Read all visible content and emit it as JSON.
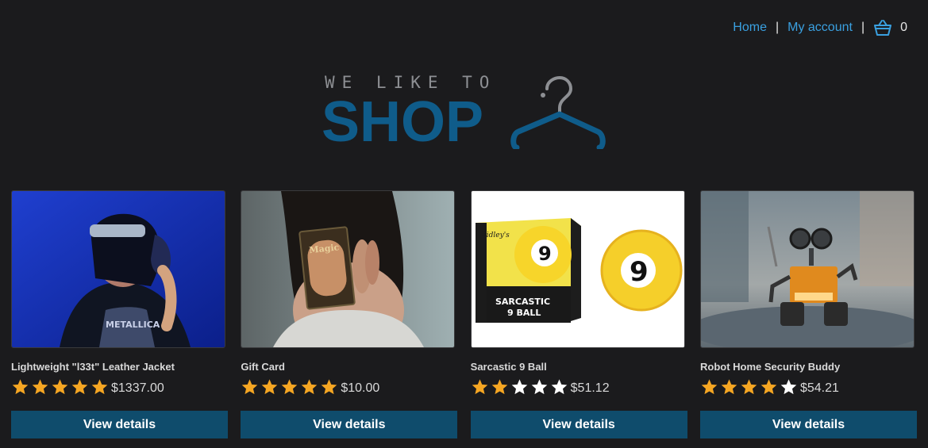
{
  "nav": {
    "home": "Home",
    "account": "My account",
    "separator": "|",
    "cart_icon": "basket-icon",
    "cart_count": "0"
  },
  "logo": {
    "top_text": "WE LIKE TO",
    "main_text": "SHOP",
    "icon": "hanger-icon"
  },
  "colors": {
    "background": "#1b1b1d",
    "link": "#3aa0e0",
    "brand": "#0f5c8a",
    "button": "#0f4c6c",
    "star_filled": "#f5a623",
    "star_empty": "#ffffff"
  },
  "products": [
    {
      "name": "Lightweight \"l33t\" Leather Jacket",
      "rating": 5,
      "price": "$1337.00",
      "button": "View details",
      "image": "person-with-headphones-and-sunglasses"
    },
    {
      "name": "Gift Card",
      "rating": 5,
      "price": "$10.00",
      "button": "View details",
      "image": "person-holding-trading-card"
    },
    {
      "name": "Sarcastic 9 Ball",
      "rating": 2,
      "price": "$51.12",
      "button": "View details",
      "image": "sarcastic-9-ball-box-and-ball"
    },
    {
      "name": "Robot Home Security Buddy",
      "rating": 4,
      "price": "$54.21",
      "button": "View details",
      "image": "toy-robot"
    }
  ]
}
